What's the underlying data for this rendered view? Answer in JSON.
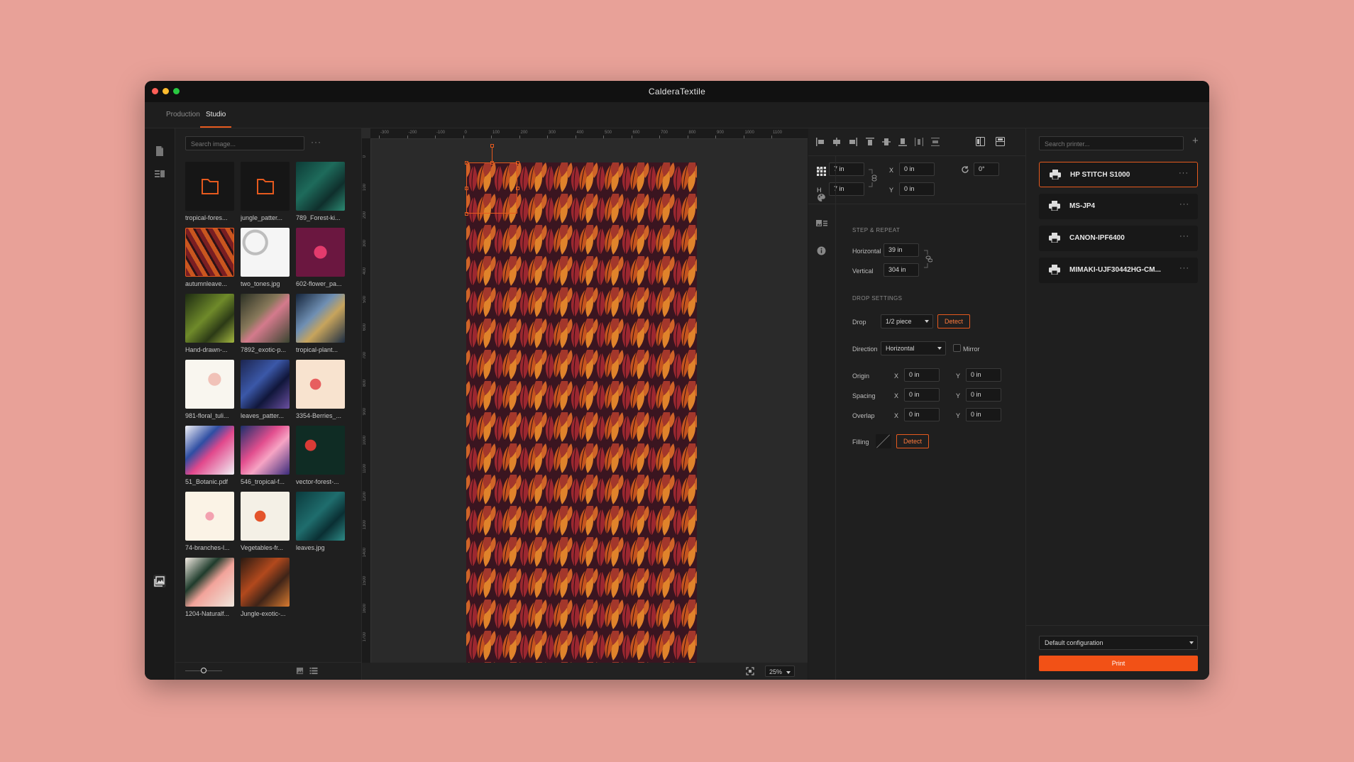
{
  "window": {
    "title": "CalderaTextile"
  },
  "tabs": [
    {
      "label": "Production"
    },
    {
      "label": "Studio"
    }
  ],
  "library": {
    "search_placeholder": "Search image...",
    "items": [
      {
        "label": "tropical-fores...",
        "kind": "folder"
      },
      {
        "label": "jungle_patter...",
        "kind": "folder"
      },
      {
        "label": "789_Forest-ki...",
        "kind": "image"
      },
      {
        "label": "autumnleave...",
        "kind": "image",
        "selected": true
      },
      {
        "label": "two_tones.jpg",
        "kind": "image"
      },
      {
        "label": "602-flower_pa...",
        "kind": "image"
      },
      {
        "label": "Hand-drawn-...",
        "kind": "image"
      },
      {
        "label": "7892_exotic-p...",
        "kind": "image"
      },
      {
        "label": "tropical-plant...",
        "kind": "image"
      },
      {
        "label": "981-floral_tuli...",
        "kind": "image"
      },
      {
        "label": "leaves_patter...",
        "kind": "image"
      },
      {
        "label": "3354-Berries_...",
        "kind": "image"
      },
      {
        "label": "51_Botanic.pdf",
        "kind": "image"
      },
      {
        "label": "546_tropical-f...",
        "kind": "image"
      },
      {
        "label": "vector-forest-...",
        "kind": "image"
      },
      {
        "label": "74-branches-l...",
        "kind": "image"
      },
      {
        "label": "Vegetables-fr...",
        "kind": "image"
      },
      {
        "label": "leaves.jpg",
        "kind": "image"
      },
      {
        "label": "1204-Naturalf...",
        "kind": "image"
      },
      {
        "label": "Jungle-exotic-...",
        "kind": "image"
      }
    ]
  },
  "canvas": {
    "ruler_x": [
      "-300",
      "-200",
      "-100",
      "0",
      "100",
      "200",
      "300",
      "400",
      "500",
      "600",
      "700",
      "800",
      "900",
      "1000",
      "1100"
    ],
    "ruler_y": [
      "0",
      "100",
      "200",
      "300",
      "400",
      "500",
      "600",
      "700",
      "800",
      "900",
      "1000",
      "1100",
      "1200",
      "1300",
      "1400",
      "1500",
      "1600",
      "1700"
    ],
    "zoom": "25%"
  },
  "transform": {
    "w_label": "W",
    "w_value": "7 in",
    "h_label": "H",
    "h_value": "7 in",
    "x_label": "X",
    "x_value": "0 in",
    "y_label": "Y",
    "y_value": "0 in",
    "rotation": "0°"
  },
  "step_repeat": {
    "heading": "STEP & REPEAT",
    "horizontal_label": "Horizontal",
    "horizontal_value": "39 in",
    "vertical_label": "Vertical",
    "vertical_value": "304 in"
  },
  "drop": {
    "heading": "DROP SETTINGS",
    "drop_label": "Drop",
    "drop_value": "1/2 piece",
    "detect": "Detect",
    "direction_label": "Direction",
    "direction_value": "Horizontal",
    "mirror_label": "Mirror",
    "origin_label": "Origin",
    "origin_x": "0 in",
    "origin_y": "0 in",
    "spacing_label": "Spacing",
    "spacing_x": "0 in",
    "spacing_y": "0 in",
    "overlap_label": "Overlap",
    "overlap_x": "0 in",
    "overlap_y": "0 in",
    "x": "X",
    "y": "Y",
    "filling_label": "Filling",
    "filling_detect": "Detect"
  },
  "printers": {
    "search_placeholder": "Search printer...",
    "add": "+",
    "items": [
      {
        "name": "HP STITCH S1000",
        "selected": true
      },
      {
        "name": "MS-JP4"
      },
      {
        "name": "CANON-IPF6400"
      },
      {
        "name": "MIMAKI-UJF30442HG-CM..."
      }
    ],
    "config": "Default configuration",
    "print": "Print"
  },
  "colors": {
    "accent": "#e65a1e",
    "print_button": "#f25116",
    "background": "#e8a198"
  }
}
